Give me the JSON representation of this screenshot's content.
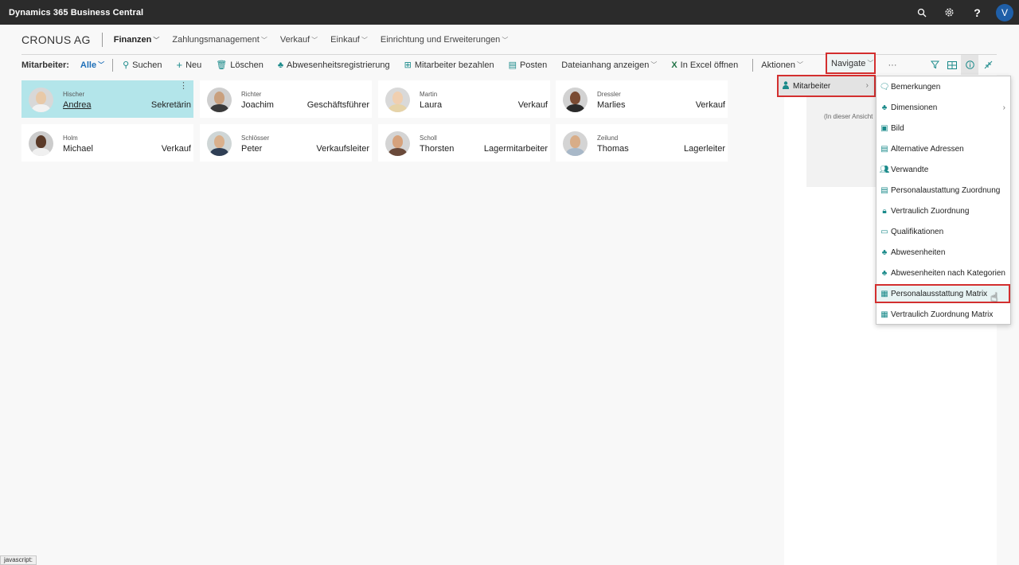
{
  "topbar": {
    "brand": "Dynamics 365 Business Central",
    "icons": [
      "search-icon",
      "gear-icon",
      "help-icon"
    ],
    "avatar": "V"
  },
  "nav": {
    "company": "CRONUS AG",
    "items": [
      {
        "label": "Finanzen"
      },
      {
        "label": "Zahlungsmanagement"
      },
      {
        "label": "Verkauf"
      },
      {
        "label": "Einkauf"
      },
      {
        "label": "Einrichtung und Erweiterungen"
      }
    ]
  },
  "actionbar": {
    "title": "Mitarbeiter:",
    "filter": "Alle",
    "items": [
      {
        "label": "Suchen",
        "icon": "search-icon"
      },
      {
        "label": "Neu",
        "icon": "plus-icon"
      },
      {
        "label": "Löschen",
        "icon": "trash-icon"
      },
      {
        "label": "Abwesenheitsregistrierung",
        "icon": "absence-icon"
      },
      {
        "label": "Mitarbeiter bezahlen",
        "icon": "payment-icon"
      },
      {
        "label": "Posten",
        "icon": "ledger-icon"
      },
      {
        "label": "Dateianhang anzeigen"
      },
      {
        "label": "In Excel öffnen",
        "icon": "excel-icon"
      }
    ],
    "aktionen": "Aktionen",
    "navigate": "Navigate",
    "more": "···"
  },
  "cards": [
    {
      "last": "Hischer",
      "first": "Andrea",
      "job": "Sekretärin",
      "skin": "#e8c9a8",
      "shirt": "#f2f2f2",
      "bg": "#d8d8d8"
    },
    {
      "last": "Richter",
      "first": "Joachim",
      "job": "Geschäftsführer",
      "skin": "#c9a07e",
      "shirt": "#3a3a3a",
      "bg": "#cfcfcf"
    },
    {
      "last": "Martin",
      "first": "Laura",
      "job": "Verkauf",
      "skin": "#f0cfb0",
      "shirt": "#e6d3a8",
      "bg": "#d9d9d9"
    },
    {
      "last": "Dressler",
      "first": "Marlies",
      "job": "Verkauf",
      "skin": "#7a4b33",
      "shirt": "#2a2a2a",
      "bg": "#d2d2d2"
    },
    {
      "last": "Holm",
      "first": "Michael",
      "job": "Verkauf",
      "skin": "#5a3a28",
      "shirt": "#f0f0f0",
      "bg": "#cccccc"
    },
    {
      "last": "Schlösser",
      "first": "Peter",
      "job": "Verkaufsleiter",
      "skin": "#d9b08c",
      "shirt": "#2f3f55",
      "bg": "#cfd6d6"
    },
    {
      "last": "Scholl",
      "first": "Thorsten",
      "job": "Lagermitarbeiter",
      "skin": "#d6a27c",
      "shirt": "#6a4a3a",
      "bg": "#d4d4d4"
    },
    {
      "last": "Zeilund",
      "first": "Thomas",
      "job": "Lagerleiter",
      "skin": "#d8ad88",
      "shirt": "#a8b8c8",
      "bg": "#d4d4d4"
    }
  ],
  "rightpane": {
    "text": "(In dieser Ansicht"
  },
  "submenu": {
    "label": "Mitarbeiter"
  },
  "menu": [
    {
      "label": "Bemerkungen",
      "icon": "comment-icon"
    },
    {
      "label": "Dimensionen",
      "icon": "dimensions-icon",
      "submenu": true
    },
    {
      "label": "Bild",
      "icon": "picture-icon"
    },
    {
      "label": "Alternative Adressen",
      "icon": "address-icon"
    },
    {
      "label": "Verwandte",
      "icon": "relatives-icon"
    },
    {
      "label": "Personalaustattung Zuordnung",
      "icon": "equipment-icon"
    },
    {
      "label": "Vertraulich Zuordnung",
      "icon": "lock-icon"
    },
    {
      "label": "Qualifikationen",
      "icon": "qualification-icon"
    },
    {
      "label": "Abwesenheiten",
      "icon": "absence-icon"
    },
    {
      "label": "Abwesenheiten nach Kategorien",
      "icon": "absence-category-icon"
    },
    {
      "label": "Personalausstattung Matrix",
      "icon": "matrix-icon",
      "highlight": true
    },
    {
      "label": "Vertraulich Zuordnung Matrix",
      "icon": "matrix-icon"
    }
  ],
  "status": "javascript:"
}
